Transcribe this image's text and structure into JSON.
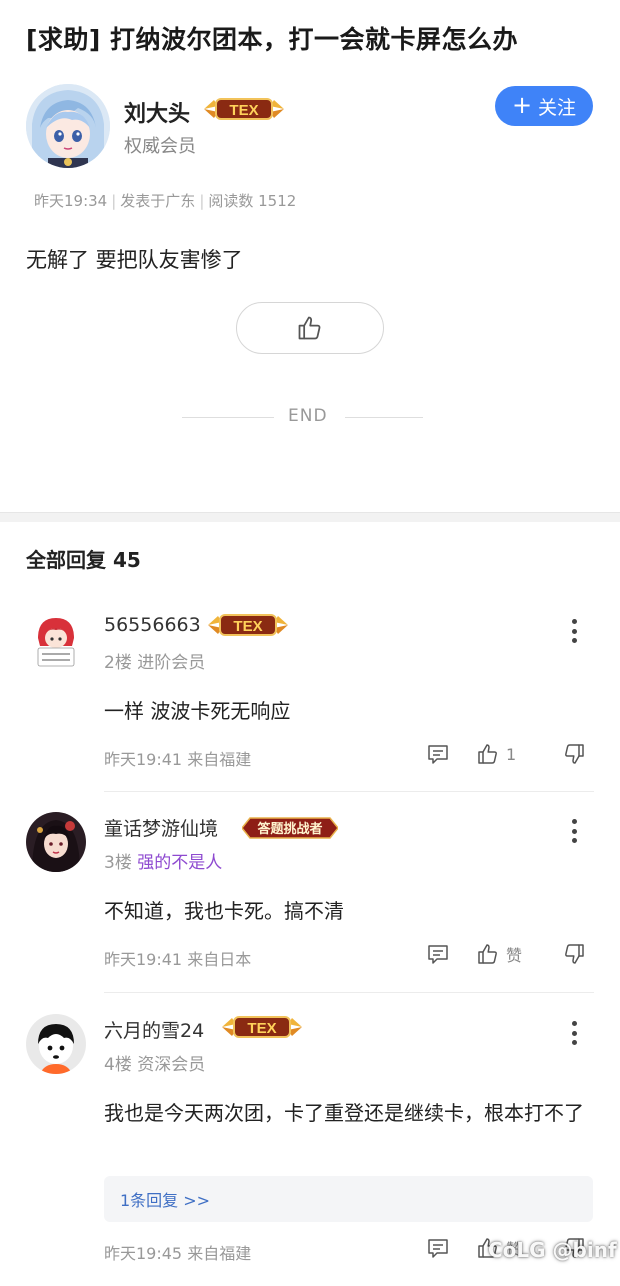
{
  "post": {
    "title": "[求助] 打纳波尔团本，打一会就卡屏怎么办",
    "author": {
      "name": "刘大头",
      "role": "权威会员",
      "badge": "TEX"
    },
    "follow_label": "关注",
    "meta": {
      "time": "昨天19:34",
      "location": "发表于广东",
      "reads": "阅读数 1512"
    },
    "body": "无解了 要把队友害惨了",
    "end_text": "END"
  },
  "replies_header": "全部回复  45",
  "replies": [
    {
      "name": "56556663",
      "badge": "TEX",
      "floor": "2楼",
      "level": "进阶会员",
      "text": "一样  波波卡死无响应",
      "time": "昨天19:41",
      "location": "来自福建",
      "like_count": "1"
    },
    {
      "name": "童话梦游仙境",
      "badge": "答题挑战者",
      "floor": "3楼",
      "level": "强的不是人",
      "text": "不知道，我也卡死。搞不清",
      "time": "昨天19:41",
      "location": "来自日本",
      "like_count": "赞"
    },
    {
      "name": "六月的雪24",
      "badge": "TEX",
      "floor": "4楼",
      "level": "资深会员",
      "text": "我也是今天两次团，卡了重登还是继续卡，根本打不了",
      "sub_replies": "1条回复 >>",
      "time": "昨天19:45",
      "location": "来自福建",
      "like_count": "赞"
    }
  ],
  "watermark": "CoLG @binf",
  "colors": {
    "accent": "#3f83f8",
    "purple_level": "#8e4ad0",
    "link": "#3f6fc4"
  }
}
